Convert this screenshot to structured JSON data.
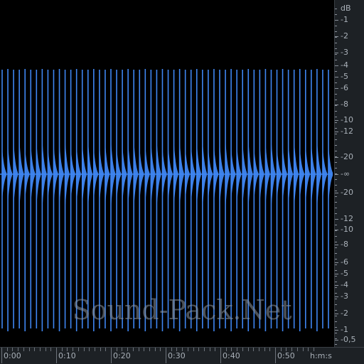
{
  "colors": {
    "background": "#000000",
    "waveform": "#3f86f2",
    "panel": "#1d2125",
    "text": "#a9b0b8"
  },
  "db_scale": {
    "unit": "dB",
    "labels": [
      "-1",
      "-2",
      "-3",
      "-4",
      "-5",
      "-6",
      "-8",
      "-10",
      "-12",
      "-20",
      "-∞",
      "-20",
      "-12",
      "-10",
      "-8",
      "-6",
      "-5",
      "-4",
      "-3",
      "-2",
      "-1",
      "-0,5"
    ]
  },
  "time_ruler": {
    "labels": [
      "0:00",
      "0:10",
      "0:20",
      "0:30",
      "0:40",
      "0:50"
    ],
    "unit": "h:m:s"
  },
  "watermark": "Sound-Pack.Net",
  "waveform": {
    "transient_count": 58,
    "duration_seconds": 57
  }
}
